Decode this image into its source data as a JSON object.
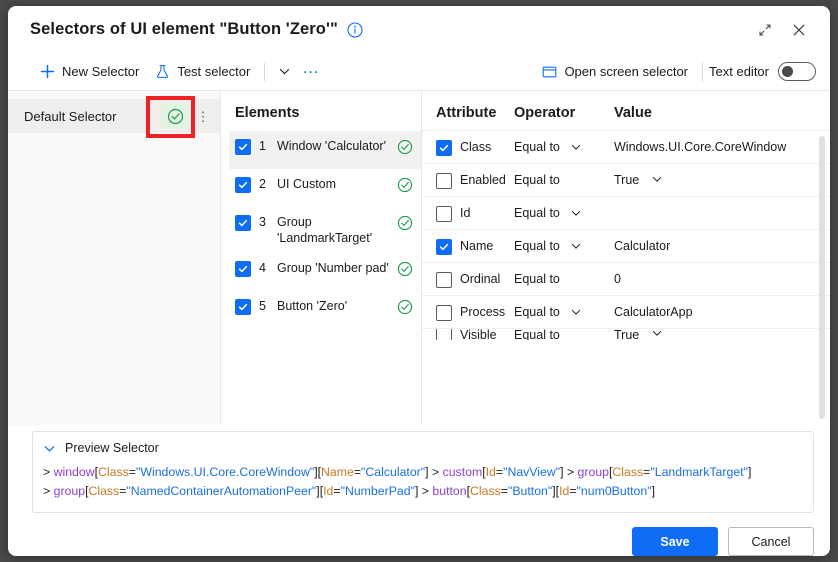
{
  "dialog": {
    "title": "Selectors of UI element \"Button 'Zero'\"",
    "info_icon": "info-icon",
    "maximize_icon": "expand-icon",
    "close_icon": "close-icon"
  },
  "toolbar": {
    "new_selector": "New Selector",
    "new_selector_icon": "plus-icon",
    "test_selector": "Test selector",
    "test_selector_icon": "flask-icon",
    "dropdown_icon": "chevron-down-icon",
    "more_icon": "ellipsis-icon",
    "open_screen_selector": "Open screen selector",
    "open_screen_selector_icon": "window-icon",
    "text_editor_label": "Text editor",
    "text_editor_on": false
  },
  "selector_list": {
    "items": [
      {
        "name": "Default Selector",
        "status": "valid",
        "status_icon": "check-circle-icon",
        "menu_icon": "kebab-menu-icon",
        "highlighted": true
      }
    ]
  },
  "elements": {
    "title": "Elements",
    "rows": [
      {
        "index": "1",
        "label": "Window 'Calculator'",
        "checked": true,
        "status_icon": "check-circle-icon",
        "selected": true
      },
      {
        "index": "2",
        "label": "UI Custom",
        "checked": true,
        "status_icon": "check-circle-icon",
        "selected": false
      },
      {
        "index": "3",
        "label": "Group 'LandmarkTarget'",
        "checked": true,
        "status_icon": "check-circle-icon",
        "selected": false
      },
      {
        "index": "4",
        "label": "Group 'Number pad'",
        "checked": true,
        "status_icon": "check-circle-icon",
        "selected": false
      },
      {
        "index": "5",
        "label": "Button 'Zero'",
        "checked": true,
        "status_icon": "check-circle-icon",
        "selected": false
      }
    ]
  },
  "attributes": {
    "headers": {
      "attribute": "Attribute",
      "operator": "Operator",
      "value": "Value"
    },
    "rows": [
      {
        "name": "Class",
        "checked": true,
        "operator": "Equal to",
        "operator_caret": true,
        "value": "Windows.UI.Core.CoreWindow",
        "value_caret": false
      },
      {
        "name": "Enabled",
        "checked": false,
        "operator": "Equal to",
        "operator_caret": false,
        "value": "True",
        "value_caret": true
      },
      {
        "name": "Id",
        "checked": false,
        "operator": "Equal to",
        "operator_caret": true,
        "value": "",
        "value_caret": false
      },
      {
        "name": "Name",
        "checked": true,
        "operator": "Equal to",
        "operator_caret": true,
        "value": "Calculator",
        "value_caret": false
      },
      {
        "name": "Ordinal",
        "checked": false,
        "operator": "Equal to",
        "operator_caret": false,
        "value": "0",
        "value_caret": false
      },
      {
        "name": "Process",
        "checked": false,
        "operator": "Equal to",
        "operator_caret": true,
        "value": "CalculatorApp",
        "value_caret": false
      },
      {
        "name": "Visible",
        "checked": false,
        "operator": "Equal to",
        "operator_caret": false,
        "value": "True",
        "value_caret": true
      }
    ]
  },
  "preview": {
    "title": "Preview Selector",
    "expand_icon": "chevron-down-icon",
    "lines": [
      [
        {
          "t": "> ",
          "k": "punc"
        },
        {
          "t": "window",
          "k": "el"
        },
        {
          "t": "[",
          "k": "punc"
        },
        {
          "t": "Class",
          "k": "attr"
        },
        {
          "t": "=",
          "k": "punc"
        },
        {
          "t": "\"Windows.UI.Core.CoreWindow\"",
          "k": "str"
        },
        {
          "t": "]",
          "k": "punc"
        },
        {
          "t": "[",
          "k": "punc"
        },
        {
          "t": "Name",
          "k": "attr"
        },
        {
          "t": "=",
          "k": "punc"
        },
        {
          "t": "\"Calculator\"",
          "k": "str"
        },
        {
          "t": "]",
          "k": "punc"
        },
        {
          "t": " > ",
          "k": "punc"
        },
        {
          "t": "custom",
          "k": "el"
        },
        {
          "t": "[",
          "k": "punc"
        },
        {
          "t": "Id",
          "k": "attr"
        },
        {
          "t": "=",
          "k": "punc"
        },
        {
          "t": "\"NavView\"",
          "k": "str"
        },
        {
          "t": "]",
          "k": "punc"
        },
        {
          "t": " > ",
          "k": "punc"
        },
        {
          "t": "group",
          "k": "el"
        },
        {
          "t": "[",
          "k": "punc"
        },
        {
          "t": "Class",
          "k": "attr"
        },
        {
          "t": "=",
          "k": "punc"
        },
        {
          "t": "\"LandmarkTarget\"",
          "k": "str"
        },
        {
          "t": "]",
          "k": "punc"
        }
      ],
      [
        {
          "t": "> ",
          "k": "punc"
        },
        {
          "t": "group",
          "k": "el"
        },
        {
          "t": "[",
          "k": "punc"
        },
        {
          "t": "Class",
          "k": "attr"
        },
        {
          "t": "=",
          "k": "punc"
        },
        {
          "t": "\"NamedContainerAutomationPeer\"",
          "k": "str"
        },
        {
          "t": "]",
          "k": "punc"
        },
        {
          "t": "[",
          "k": "punc"
        },
        {
          "t": "Id",
          "k": "attr"
        },
        {
          "t": "=",
          "k": "punc"
        },
        {
          "t": "\"NumberPad\"",
          "k": "str"
        },
        {
          "t": "]",
          "k": "punc"
        },
        {
          "t": " > ",
          "k": "punc"
        },
        {
          "t": "button",
          "k": "el"
        },
        {
          "t": "[",
          "k": "punc"
        },
        {
          "t": "Class",
          "k": "attr"
        },
        {
          "t": "=",
          "k": "punc"
        },
        {
          "t": "\"Button\"",
          "k": "str"
        },
        {
          "t": "]",
          "k": "punc"
        },
        {
          "t": "[",
          "k": "punc"
        },
        {
          "t": "Id",
          "k": "attr"
        },
        {
          "t": "=",
          "k": "punc"
        },
        {
          "t": "\"num0Button\"",
          "k": "str"
        },
        {
          "t": "]",
          "k": "punc"
        }
      ]
    ]
  },
  "footer": {
    "save": "Save",
    "cancel": "Cancel"
  },
  "colors": {
    "accent": "#0f6cf5",
    "success": "#1a9c4a",
    "highlight": "#ee2222"
  }
}
